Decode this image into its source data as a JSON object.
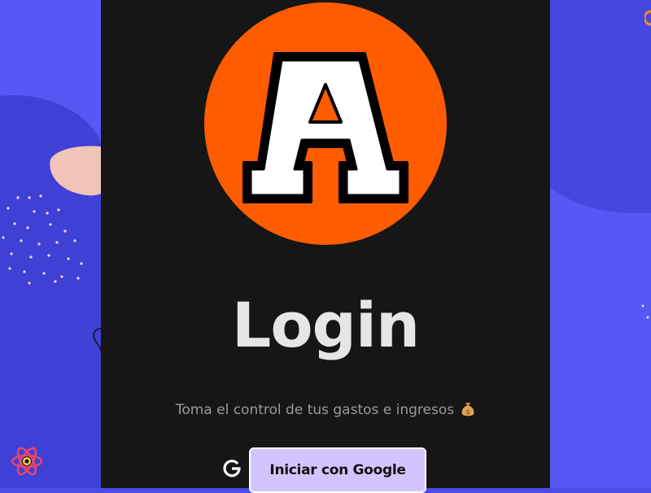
{
  "login": {
    "logo_letter": "A",
    "title": "Login",
    "subtitle": "Toma el control de tus gastos e ingresos",
    "subtitle_icon": "money-bag-icon",
    "google_icon": "google-icon",
    "google_button_label": "Iniciar con Google"
  },
  "colors": {
    "background": "#4a4ee6",
    "card": "#161616",
    "logo_circle": "#ff5c00",
    "title": "#e6e6e6",
    "subtitle": "#9a9a9a",
    "button": "#d3c4ff",
    "button_border": "#ffffff"
  },
  "decorations": [
    "react-icon",
    "dots-pattern",
    "squiggle"
  ]
}
